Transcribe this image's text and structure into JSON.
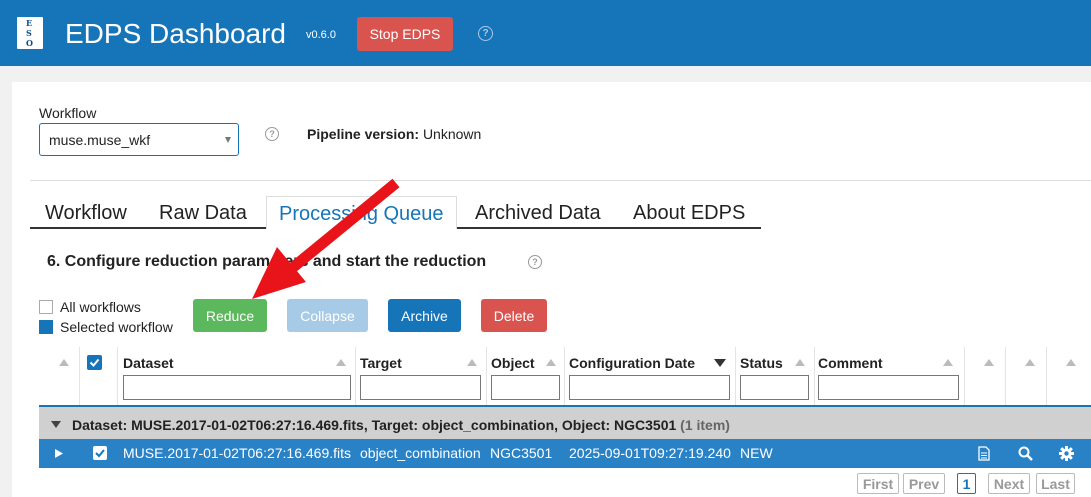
{
  "header": {
    "logo_letters": [
      "E",
      "S",
      "O"
    ],
    "title": "EDPS Dashboard",
    "version": "v0.6.0",
    "stop_label": "Stop EDPS",
    "help": "?"
  },
  "workflow": {
    "label": "Workflow",
    "selected": "muse.muse_wkf",
    "help": "?",
    "pipeline_label": "Pipeline version:",
    "pipeline_value": "Unknown"
  },
  "tabs": [
    {
      "label": "Workflow"
    },
    {
      "label": "Raw Data"
    },
    {
      "label": "Processing Queue"
    },
    {
      "label": "Archived Data"
    },
    {
      "label": "About EDPS"
    }
  ],
  "section": {
    "title": "6. Configure reduction parameters and start the reduction",
    "help": "?"
  },
  "legend": {
    "all": "All workflows",
    "selected": "Selected workflow"
  },
  "actions": {
    "reduce": "Reduce",
    "collapse": "Collapse",
    "archive": "Archive",
    "delete": "Delete"
  },
  "columns": [
    "Dataset",
    "Target",
    "Object",
    "Configuration Date",
    "Status",
    "Comment"
  ],
  "group": {
    "label": "Dataset: MUSE.2017-01-02T06:27:16.469.fits, Target: object_combination, Object: NGC3501",
    "count": "(1 item)"
  },
  "row": {
    "dataset": "MUSE.2017-01-02T06:27:16.469.fits",
    "target": "object_combination",
    "object": "NGC3501",
    "config_date": "2025-09-01T09:27:19.240",
    "status": "NEW",
    "checked": true
  },
  "pager": {
    "first": "First",
    "prev": "Prev",
    "page": "1",
    "next": "Next",
    "last": "Last"
  },
  "colors": {
    "header": "#1675b9",
    "reduce": "#5cb85c",
    "collapse": "#a7cbe6",
    "archive": "#1675b9",
    "delete": "#d9534f",
    "row_selected": "#2a82c6",
    "annotation_arrow": "#e8141a"
  }
}
